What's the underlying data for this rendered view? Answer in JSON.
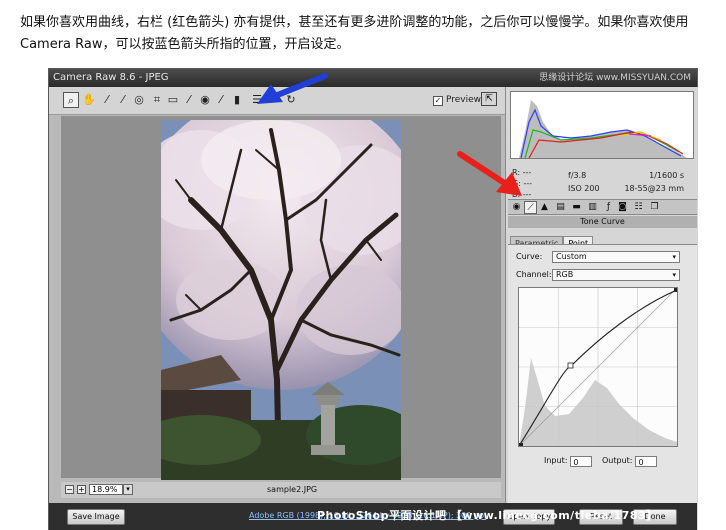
{
  "intro_text": "如果你喜欢用曲线，右栏 (红色箭头) 亦有提供，甚至还有更多进阶调整的功能，之后你可以慢慢学。如果你喜欢使用 Camera Raw，可以按蓝色箭头所指的位置，开启设定。",
  "window": {
    "title": "Camera Raw 8.6 - JPEG",
    "watermark_top": "思缘设计论坛 www.MISSYUAN.COM"
  },
  "toolbar": {
    "preview_label": "Preview",
    "preview_checked": "✓",
    "tools": [
      "zoom-icon",
      "hand-icon",
      "white-balance-icon",
      "color-sampler-icon",
      "target-adjust-icon",
      "crop-icon",
      "straighten-icon",
      "spot-removal-icon",
      "red-eye-icon",
      "adjustment-brush-icon",
      "graduated-filter-icon",
      "radial-filter-icon",
      "preferences-icon",
      "rotate-ccw-icon",
      "rotate-cw-icon"
    ]
  },
  "histogram": {
    "r_label": "R:",
    "g_label": "G:",
    "b_label": "B:",
    "r_value": "---",
    "g_value": "---",
    "b_value": "---",
    "aperture": "f/3.8",
    "shutter": "1/1600 s",
    "iso": "ISO 200",
    "lens": "18-55@23 mm"
  },
  "panel": {
    "title": "Tone Curve",
    "subtab_parametric": "Parametric",
    "subtab_point": "Point",
    "curve_label": "Curve:",
    "curve_value": "Custom",
    "channel_label": "Channel:",
    "channel_value": "RGB",
    "input_label": "Input:",
    "input_value": "0",
    "output_label": "Output:",
    "output_value": "0"
  },
  "status": {
    "zoom_minus": "−",
    "zoom_plus": "+",
    "zoom_value": "18.9%",
    "filename": "sample2.JPG"
  },
  "bottom": {
    "save_label": "Save Image",
    "workflow_link": "Adobe RGB (1998); 16 bit; 3264 by 4928 (16.1MP); 300 ppi",
    "open_label": "Open Copy",
    "cancel_label": "Reset",
    "done_label": "Done",
    "watermark": "PhotoShop平面设计吧 【www.linecg.com/tieba/1783】"
  },
  "colors": {
    "red_arrow": "#e8201a",
    "blue_arrow": "#1f3fd6"
  }
}
